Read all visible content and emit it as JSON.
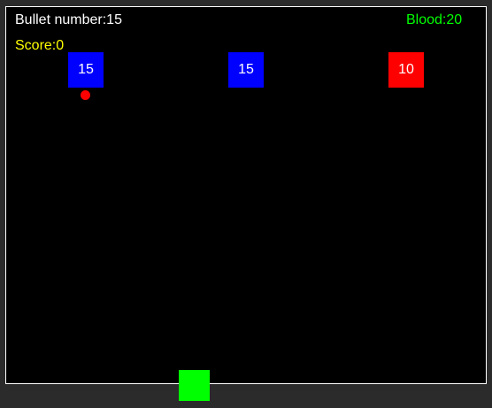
{
  "hud": {
    "bullets_label": "Bullet number:15",
    "blood_label": "Blood:20",
    "score_label": "Score:0"
  },
  "enemies": [
    {
      "value": "15",
      "color": "#0000ff"
    },
    {
      "value": "15",
      "color": "#0000ff"
    },
    {
      "value": "10",
      "color": "#ff0000"
    }
  ],
  "bullet": {
    "color": "#ff0000"
  },
  "player": {
    "color": "#00ff00"
  },
  "colors": {
    "background": "#000000",
    "frame": "#2b2b2b",
    "hud_text": "#ffffff",
    "blood_text": "#00ff00",
    "score_text": "#ffff00"
  }
}
